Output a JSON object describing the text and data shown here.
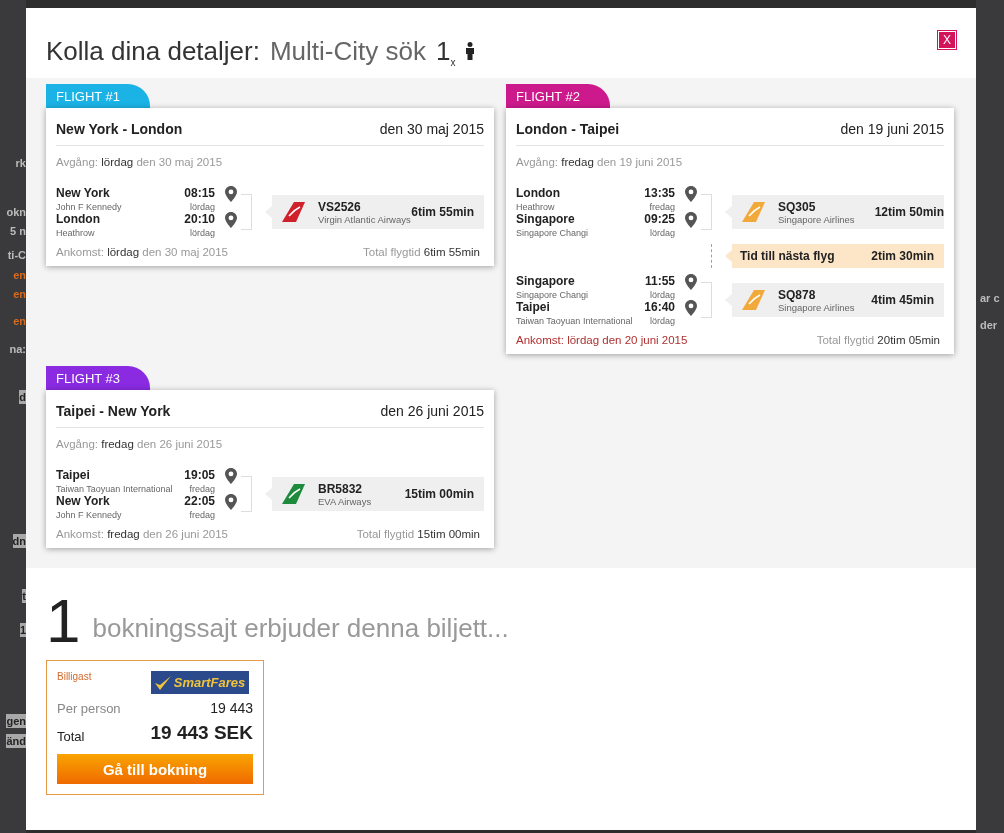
{
  "background_page": {
    "left_fragments": [
      {
        "text": "rk",
        "kind": "plain"
      },
      {
        "text": "okn",
        "kind": "plain"
      },
      {
        "text": "5 n",
        "kind": "plain"
      },
      {
        "text": "ti-C",
        "kind": "plain"
      },
      {
        "text": "en",
        "kind": "accent"
      },
      {
        "text": "en",
        "kind": "accent"
      },
      {
        "text": "en",
        "kind": "accent"
      },
      {
        "text": "na:",
        "kind": "plain"
      },
      {
        "text": "d",
        "kind": "panel"
      },
      {
        "text": "dn",
        "kind": "panel"
      },
      {
        "text": "t",
        "kind": "panel"
      },
      {
        "text": "1",
        "kind": "panel"
      },
      {
        "text": "gen",
        "kind": "panel"
      },
      {
        "text": "änd",
        "kind": "panel"
      }
    ],
    "right_fragments": [
      {
        "text": "ar c"
      },
      {
        "text": "der"
      }
    ]
  },
  "modal": {
    "title": "Kolla dina detaljer:",
    "subtitle": "Multi-City sök",
    "passengers": "1$_{x}$",
    "close": "X"
  },
  "flights": [
    {
      "label": "FLIGHT #1",
      "color": "#1bb3e6",
      "route": "New York - London",
      "date": "den 30 maj 2015",
      "departure": {
        "label": "Avgång:",
        "day": "lördag",
        "date": "den 30 maj 2015"
      },
      "legs": [
        {
          "kind": "flight",
          "from": {
            "city": "New York",
            "airport": "John F Kennedy",
            "time": "08:15",
            "day": "lördag"
          },
          "to": {
            "city": "London",
            "airport": "Heathrow",
            "time": "20:10",
            "day": "lördag"
          },
          "code": "VS2526",
          "airline": "Virgin Atlantic Airways",
          "duration": "6tim 55min",
          "color": "#d0202a"
        }
      ],
      "arrival": {
        "label": "Ankomst:",
        "day": "lördag",
        "date": "den 30 maj 2015",
        "alert": false
      },
      "total": {
        "label": "Total flygtid",
        "value": "6tim 55min"
      }
    },
    {
      "label": "FLIGHT #2",
      "color": "#cc1a8c",
      "route": "London - Taipei",
      "date": "den 19 juni 2015",
      "departure": {
        "label": "Avgång:",
        "day": "fredag",
        "date": "den 19 juni 2015"
      },
      "legs": [
        {
          "kind": "flight",
          "from": {
            "city": "London",
            "airport": "Heathrow",
            "time": "13:35",
            "day": "fredag"
          },
          "to": {
            "city": "Singapore",
            "airport": "Singapore Changi",
            "time": "09:25",
            "day": "lördag"
          },
          "code": "SQ305",
          "airline": "Singapore Airlines",
          "duration": "12tim 50min",
          "color": "#f2a93b"
        },
        {
          "kind": "layover",
          "label": "Tid till nästa flyg",
          "duration": "2tim 30min"
        },
        {
          "kind": "flight",
          "from": {
            "city": "Singapore",
            "airport": "Singapore Changi",
            "time": "11:55",
            "day": "lördag"
          },
          "to": {
            "city": "Taipei",
            "airport": "Taiwan Taoyuan International",
            "time": "16:40",
            "day": "lördag"
          },
          "code": "SQ878",
          "airline": "Singapore Airlines",
          "duration": "4tim 45min",
          "color": "#f2a93b"
        }
      ],
      "arrival": {
        "label": "Ankomst:",
        "day": "lördag",
        "date": "den 20 juni 2015",
        "alert": true
      },
      "total": {
        "label": "Total flygtid",
        "value": "20tim 05min"
      }
    },
    {
      "label": "FLIGHT #3",
      "color": "#8a2be2",
      "route": "Taipei - New York",
      "date": "den 26 juni 2015",
      "departure": {
        "label": "Avgång:",
        "day": "fredag",
        "date": "den 26 juni 2015"
      },
      "legs": [
        {
          "kind": "flight",
          "from": {
            "city": "Taipei",
            "airport": "Taiwan Taoyuan International",
            "time": "19:05",
            "day": "fredag"
          },
          "to": {
            "city": "New York",
            "airport": "John F Kennedy",
            "time": "22:05",
            "day": "fredag"
          },
          "code": "BR5832",
          "airline": "EVA Airways",
          "duration": "15tim 00min",
          "color": "#1d8a3c"
        }
      ],
      "arrival": {
        "label": "Ankomst:",
        "day": "fredag",
        "date": "den 26 juni 2015",
        "alert": false
      },
      "total": {
        "label": "Total flygtid",
        "value": "15tim 00min"
      }
    }
  ],
  "booking": {
    "count": "1",
    "heading": "bokningssajt erbjuder denna biljett...",
    "offers": [
      {
        "badge": "Billigast",
        "provider": "SmartFares",
        "per_person_label": "Per person",
        "per_person": "19 443",
        "total_label": "Total",
        "total": "19 443 SEK",
        "button": "Gå till bokning"
      }
    ]
  }
}
